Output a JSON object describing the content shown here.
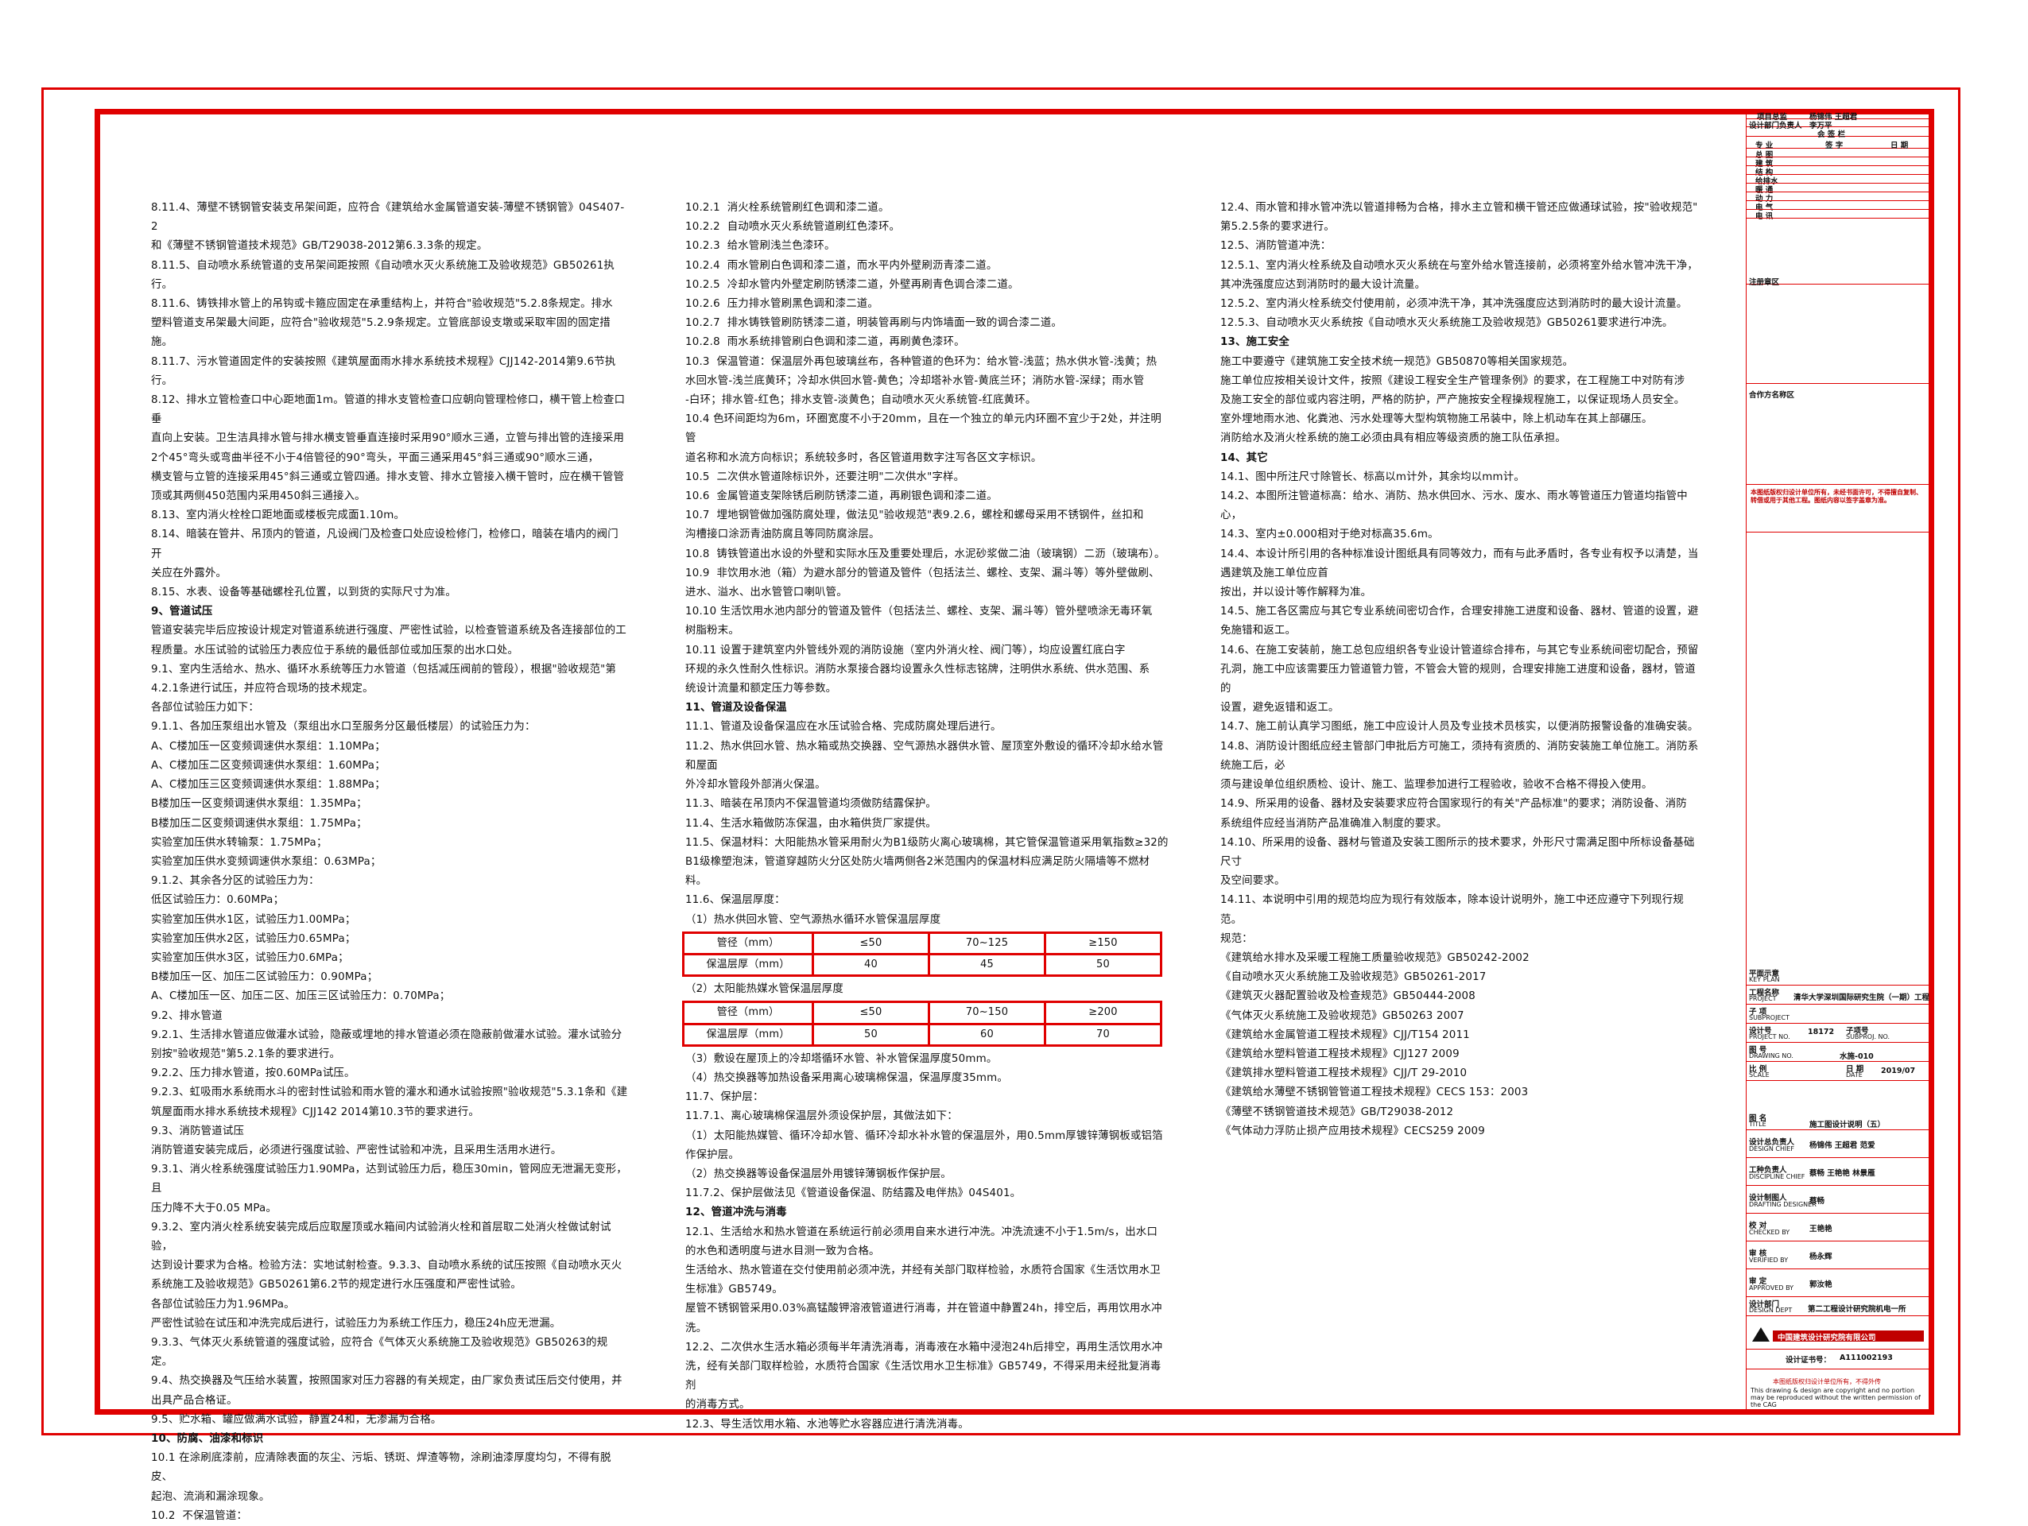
{
  "col1": [
    "8.11.4、薄壁不锈钢管安装支吊架间距，应符合《建筑给水金属管道安装-薄壁不锈钢管》04S407-2",
    "和《薄壁不锈钢管道技术规范》GB/T29038-2012第6.3.3条的规定。",
    "8.11.5、自动喷水系统管道的支吊架间距按照《自动喷水灭火系统施工及验收规范》GB50261执行。",
    "8.11.6、铸铁排水管上的吊钩或卡箍应固定在承重结构上，并符合\"验收规范\"5.2.8条规定。排水",
    "塑料管道支吊架最大间距，应符合\"验收规范\"5.2.9条规定。立管底部设支墩或采取牢固的固定措施。",
    "",
    "8.11.7、污水管道固定件的安装按照《建筑屋面雨水排水系统技术规程》CJJ142-2014第9.6节执行。",
    "8.12、排水立管检查口中心距地面1m。管道的排水支管检查口应朝向管理检修口，横干管上检查口垂",
    "直向上安装。卫生洁具排水管与排水横支管垂直连接时采用90°顺水三通，立管与排出管的连接采用",
    "2个45°弯头或弯曲半径不小于4倍管径的90°弯头，平面三通采用45°斜三通或90°顺水三通，",
    "横支管与立管的连接采用45°斜三通或立管四通。排水支管、排水立管接入横干管时，应在横干管管",
    "顶或其两侧450范围内采用450斜三通接入。",
    "8.13、室内消火栓栓口距地面或楼板完成面1.10m。",
    "8.14、暗装在管井、吊顶内的管道，凡设阀门及检查口处应设检修门，检修口，暗装在墙内的阀门开",
    "关应在外露外。",
    "8.15、水表、设备等基础螺栓孔位置，以到货的实际尺寸为准。",
    "§9、管道试压",
    "管道安装完毕后应按设计规定对管道系统进行强度、严密性试验，以检查管道系统及各连接部位的工",
    "程质量。水压试验的试验压力表应位于系统的最低部位或加压泵的出水口处。",
    "9.1、室内生活给水、热水、循环水系统等压力水管道（包括减压阀前的管段），根据\"验收规范\"第",
    "4.2.1条进行试压，并应符合现场的技术规定。",
    "各部位试验压力如下：",
    "9.1.1、各加压泵组出水管及（泵组出水口至服务分区最低楼层）的试验压力为：",
    "A、C楼加压一区变频调速供水泵组：1.10MPa；",
    "A、C楼加压二区变频调速供水泵组：1.60MPa；",
    "A、C楼加压三区变频调速供水泵组：1.88MPa；",
    "B楼加压一区变频调速供水泵组：1.35MPa；",
    "B楼加压二区变频调速供水泵组：1.75MPa；",
    "实验室加压供水转输泵：1.75MPa；",
    "实验室加压供水变频调速供水泵组：0.63MPa；",
    "9.1.2、其余各分区的试验压力为：",
    "低区试验压力：0.60MPa；",
    "实验室加压供水1区，试验压力1.00MPa；",
    "实验室加压供水2区，试验压力0.65MPa；",
    "实验室加压供水3区，试验压力0.6MPa；",
    "B楼加压一区、加压二区试验压力：0.90MPa；",
    "A、C楼加压一区、加压二区、加压三区试验压力：0.70MPa；",
    "9.2、排水管道",
    "9.2.1、生活排水管道应做灌水试验，隐蔽或埋地的排水管道必须在隐蔽前做灌水试验。灌水试验分",
    "别按\"验收规范\"第5.2.1条的要求进行。",
    "9.2.2、压力排水管道，按0.60MPa试压。",
    "9.2.3、虹吸雨水系统雨水斗的密封性试验和雨水管的灌水和通水试验按照\"验收规范\"5.3.1条和《建",
    "筑屋面雨水排水系统技术规程》CJJ142 2014第10.3节的要求进行。",
    "9.3、消防管道试压",
    "消防管道安装完成后，必须进行强度试验、严密性试验和冲洗，且采用生活用水进行。",
    "9.3.1、消火栓系统强度试验压力1.90MPa，达到试验压力后，稳压30min，管网应无泄漏无变形，且",
    "压力降不大于0.05 MPa。",
    "9.3.2、室内消火栓系统安装完成后应取屋顶或水箱间内试验消火栓和首层取二处消火栓做试射试验，",
    "达到设计要求为合格。检验方法：实地试射检查。9.3.3、自动喷水系统的试压按照《自动喷水灭火",
    "系统施工及验收规范》GB50261第6.2节的规定进行水压强度和严密性试验。",
    "各部位试验压力为1.96MPa。",
    "严密性试验在试压和冲洗完成后进行，试验压力为系统工作压力，稳压24h应无泄漏。",
    "9.3.3、气体灭火系统管道的强度试验，应符合《气体灭火系统施工及验收规范》GB50263的规定。",
    "9.4、热交换器及气压给水装置，按照国家对压力容器的有关规定，由厂家负责试压后交付使用，并",
    "出具产品合格证。",
    "9.5、贮水箱、罐应做满水试验，静置24和，无渗漏为合格。",
    "§10、防腐、油漆和标识",
    "10.1 在涂刷底漆前，应清除表面的灰尘、污垢、锈斑、焊渣等物，涂刷油漆厚度均匀，不得有脱皮、",
    "起泡、流淌和漏涂现象。",
    "10.2  不保温管道："
  ],
  "col2a": [
    "10.2.1  消火栓系统管刷红色调和漆二道。",
    "10.2.2  自动喷水灭火系统管道刷红色漆环。",
    "10.2.3  给水管刷浅兰色漆环。",
    "10.2.4  雨水管刷白色调和漆二道，而水平内外壁刷沥青漆二道。",
    "10.2.5  冷却水管内外壁定刷防锈漆二道，外壁再刷青色调合漆二道。",
    "10.2.6  压力排水管刷黑色调和漆二道。",
    "10.2.7  排水铸铁管刷防锈漆二道，明装管再刷与内饰墙面一致的调合漆二道。",
    "10.2.8  雨水系统排管刷白色调和漆二道，再刷黄色漆环。",
    "10.3  保温管道：保温层外再包玻璃丝布，各种管道的色环为：给水管-浅蓝；热水供水管-浅黄；热",
    "水回水管-浅兰底黄环；冷却水供回水管-黄色；冷却塔补水管-黄底兰环；消防水管-深绿；雨水管",
    "-白环；排水管-红色；排水支管-淡黄色；自动喷水灭火系统管-红底黄环。",
    "10.4 色环间距均为6m，环圈宽度不小于20mm，且在一个独立的单元内环圈不宜少于2处，并注明管",
    "道名称和水流方向标识；系统较多时，各区管道用数字注写各区文字标识。",
    "10.5  二次供水管道除标识外，还要注明\"二次供水\"字样。",
    "10.6  金属管道支架除锈后刷防锈漆二道，再刷银色调和漆二道。",
    "10.7  埋地钢管做加强防腐处理，做法见\"验收规范\"表9.2.6，螺栓和螺母采用不锈钢件，丝扣和",
    "沟槽接口涂沥青油防腐且等同防腐涂层。",
    "10.8  铸铁管道出水设的外壁和实际水压及重要处理后，水泥砂浆做二油（玻璃钢）二沥（玻璃布）。",
    "10.9  非饮用水池（箱）为避水部分的管道及管件（包括法兰、螺栓、支架、漏斗等）等外壁做刷、",
    "进水、溢水、出水管管口喇叭管。",
    "10.10 生活饮用水池内部分的管道及管件（包括法兰、螺栓、支架、漏斗等）管外壁喷涂无毒环氧",
    "树脂粉末。",
    "10.11 设置于建筑室内外管线外观的消防设施（室内外消火栓、阀门等），均应设置红底白字",
    "环规的永久性耐久性标识。消防水泵接合器均设置永久性标志铭牌，注明供水系统、供水范围、系",
    "统设计流量和额定压力等参数。",
    "§11、管道及设备保温",
    "11.1、管道及设备保温应在水压试验合格、完成防腐处理后进行。",
    "11.2、热水供回水管、热水箱或热交换器、空气源热水器供水管、屋顶室外敷设的循环冷却水给水管和屋面",
    "外冷却水管段外部消火保温。",
    "11.3、暗装在吊顶内不保温管道均须做防结露保护。",
    "11.4、生活水箱做防冻保温，由水箱供货厂家提供。",
    "11.5、保温材料：大阳能热水管采用耐火为B1级防火离心玻璃棉，其它管保温管道采用氧指数≥32的",
    "B1级橡塑泡沫，管道穿越防火分区处防火墙两侧各2米范围内的保温材料应满足防火隔墙等不燃材料。",
    "11.6、保温层厚度：",
    "（1）热水供回水管、空气源热水循环水管保温层厚度"
  ],
  "table1": {
    "label": "管径（mm）",
    "cells": [
      "≤50",
      "70~125",
      "≥150"
    ],
    "label2": "保温层厚（mm）",
    "cells2": [
      "40",
      "45",
      "50"
    ]
  },
  "table2_title": "（2）太阳能热媒水管保温层厚度",
  "table2": {
    "label": "管径（mm）",
    "cells": [
      "≤50",
      "70~150",
      "≥200"
    ],
    "label2": "保温层厚（mm）",
    "cells2": [
      "50",
      "60",
      "70"
    ]
  },
  "col2b": [
    "（3）敷设在屋顶上的冷却塔循环水管、补水管保温厚度50mm。",
    "（4）热交换器等加热设备采用离心玻璃棉保温，保温厚度35mm。",
    "11.7、保护层：",
    "11.7.1、离心玻璃棉保温层外须设保护层，其做法如下：",
    "（1）太阳能热媒管、循环冷却水管、循环冷却水补水管的保温层外，用0.5mm厚镀锌薄钢板或铝箔",
    "作保护层。",
    "（2）热交换器等设备保温层外用镀锌薄钢板作保护层。",
    "11.7.2、保护层做法见《管道设备保温、防结露及电伴热》04S401。",
    "§12、管道冲洗与消毒",
    "12.1、生活给水和热水管道在系统运行前必须用自来水进行冲洗。冲洗流速不小于1.5m/s，出水口",
    "的水色和透明度与进水目测一致为合格。",
    "生活给水、热水管道在交付使用前必须冲洗，并经有关部门取样检验，水质符合国家《生活饮用水卫",
    "生标准》GB5749。",
    "屋管不锈钢管采用0.03%高锰酸钾溶液管道进行消毒，并在管道中静置24h，排空后，再用饮用水冲",
    "洗。",
    "12.2、二次供水生活水箱必须每半年清洗消毒，消毒液在水箱中浸泡24h后排空，再用生活饮用水冲",
    "洗，经有关部门取样检验，水质符合国家《生活饮用水卫生标准》GB5749，不得采用未经批复消毒剂",
    "的消毒方式。",
    "12.3、导生活饮用水箱、水池等贮水容器应进行清洗消毒。"
  ],
  "col3": [
    "12.4、雨水管和排水管冲洗以管道排畅为合格，排水主立管和横干管还应做通球试验，按\"验收规范\"",
    "第5.2.5条的要求进行。",
    "12.5、消防管道冲洗：",
    "12.5.1、室内消火栓系统及自动喷水灭火系统在与室外给水管连接前，必须将室外给水管冲洗干净，",
    "其冲洗强度应达到消防时的最大设计流量。",
    "12.5.2、室内消火栓系统交付使用前，必须冲洗干净，其冲洗强度应达到消防时的最大设计流量。",
    "12.5.3、自动喷水灭火系统按《自动喷水灭火系统施工及验收规范》GB50261要求进行冲洗。",
    "§13、施工安全",
    "施工中要遵守《建筑施工安全技术统一规范》GB50870等相关国家规范。",
    "施工单位应按相关设计文件，按照《建设工程安全生产管理条例》的要求，在工程施工中对防有涉",
    "及施工安全的部位或内容注明，严格的防护，严产施按安全程操规程施工，以保证现场人员安全。",
    "室外埋地雨水池、化粪池、污水处理等大型构筑物施工吊装中，除上机动车在其上部碾压。",
    "消防给水及消火栓系统的施工必须由具有相应等级资质的施工队伍承担。",
    "§14、其它",
    "14.1、图中所注尺寸除管长、标高以m计外，其余均以mm计。",
    "14.2、本图所注管道标高：给水、消防、热水供回水、污水、废水、雨水等管道压力管道均指管中心，",
    "14.3、室内±0.000相对于绝对标高35.6m。",
    "14.4、本设计所引用的各种标准设计图纸具有同等效力，而有与此矛盾时，各专业有权予以清楚，当遇建筑及施工单位应首",
    "按出，并以设计等作解释为准。",
    "14.5、施工各区需应与其它专业系统间密切合作，合理安排施工进度和设备、器材、管道的设置，避",
    "免施错和返工。",
    "14.6、在施工安装前，施工总包应组织各专业设计管道综合排布，与其它专业系统间密切配合，预留",
    "孔洞，施工中应该需要压力管道管力管，不管会大管的规则，合理安排施工进度和设备，器材，管道的",
    "设置，避免返错和返工。",
    "14.7、施工前认真学习图纸，施工中应设计人员及专业技术员核实，以便消防报警设备的准确安装。",
    "14.8、消防设计图纸应经主管部门申批后方可施工，须持有资质的、消防安装施工单位施工。消防系统施工后，必",
    "须与建设单位组织质检、设计、施工、监理参加进行工程验收，验收不合格不得投入使用。",
    "14.9、所采用的设备、器材及安装要求应符合国家现行的有关\"产品标准\"的要求；消防设备、消防",
    "系统组件应经当消防产品准确准入制度的要求。",
    "14.10、所采用的设备、器材与管道及安装工图所示的技术要求，外形尺寸需满足图中所标设备基础尺寸",
    "及空间要求。",
    "14.11、本说明中引用的规范均应为现行有效版本，除本设计说明外，施工中还应遵守下列现行规范。",
    "规范：",
    "《建筑给水排水及采暖工程施工质量验收规范》GB50242-2002",
    "《自动喷水灭火系统施工及验收规范》GB50261-2017",
    "《建筑灭火器配置验收及检查规范》GB50444-2008",
    "《气体灭火系统施工及验收规范》GB50263 2007",
    "《建筑给水金属管道工程技术规程》CJJ/T154 2011",
    "《建筑给水塑料管道工程技术规程》CJJ127 2009",
    "《建筑排水塑料管道工程技术规程》CJJ/T 29-2010",
    "《建筑给水薄壁不锈钢管管道工程技术规程》CECS 153：2003",
    "《薄壁不锈钢管道技术规范》GB/T29038-2012",
    "《气体动力浮防止损产应用技术规程》CECS259 2009"
  ],
  "title_block": {
    "proj_director_label": "项目总监",
    "proj_director_names": "杨锦伟 王超君",
    "dept_head_label": "设计部门负责人",
    "dept_head_name": "李万平",
    "sign_header": "会 签 栏",
    "col_major": "专 业",
    "col_sign": "签 字",
    "col_date": "日 期",
    "disciplines": [
      "总 图",
      "建 筑",
      "结 构",
      "给排水",
      "暖 通",
      "动 力",
      "电 气",
      "电 讯"
    ],
    "seal_area": "注册章区",
    "collab_seal": "合作方名称区",
    "disclaimer": "本图纸版权归设计单位所有，未经书面许可，不得擅自复制、转借或用于其他工程。图纸内容以签字盖章为准。",
    "key_plan_cn": "平面示意",
    "key_plan_en": "KEY PLAN",
    "project_label_cn": "工程名称",
    "project_label_en": "PROJECT",
    "project_name": "清华大学深圳国际研究生院（一期）工程",
    "subproject_cn": "子 项",
    "subproject_en": "SUBPROJECT",
    "project_no_cn": "设计号",
    "project_no_en": "PROJECT NO.",
    "project_no": "18172",
    "subproj_no_cn": "子项号",
    "subproj_no_en": "SUBPROJ. NO.",
    "drawing_no_cn": "图 号",
    "drawing_no_en": "DRAWING NO.",
    "drawing_no": "水施-010",
    "scale_cn": "比 例",
    "scale_en": "SCALE",
    "date_cn": "日 期",
    "date_en": "DATE",
    "date_val": "2019/07",
    "title_cn": "图 名",
    "title_en": "TITLE",
    "drawing_title": "施工图设计说明（五）",
    "design_chief_cn": "设计总负责人",
    "design_chief_en": "DESIGN CHIEF",
    "design_chief": "杨锦伟 王超君 范爱",
    "discipline_chief_cn": "工种负责人",
    "discipline_chief_en": "DISCIPLINE CHIEF",
    "discipline_chief": "蔡畅 王艳艳 林景雁",
    "drafting_cn": "设计制图人",
    "drafting_en": "DRAFTING DESIGNER",
    "drafting": "蔡畅",
    "checked_cn": "校 对",
    "checked_en": "CHECKED BY",
    "checked": "王艳艳",
    "verified_cn": "审 核",
    "verified_en": "VERIFIED BY",
    "verified": "杨永辉",
    "approved_cn": "审 定",
    "approved_en": "APPROVED BY",
    "approved": "郭汝艳",
    "dept_cn": "设计部门",
    "dept_en": "DESIGN DEPT",
    "dept": "第二工程设计研究院机电一所",
    "company": "中国建筑设计研究院有限公司",
    "cert_label": "设计证书号：",
    "cert_no": "A111002193",
    "footer_cn": "本图纸版权归设计单位所有，不得外传",
    "footer_en": "This drawing & design are copyright and no portion may be reproduced without the written permission of the CAG"
  },
  "colors": {
    "frame": "#e00000",
    "text": "#111111"
  }
}
